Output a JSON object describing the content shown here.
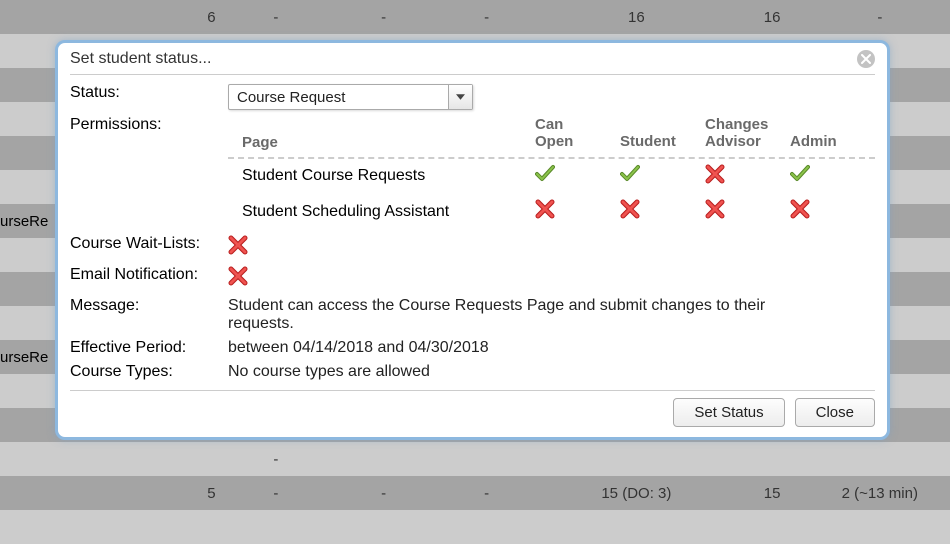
{
  "bg": {
    "partial_label": "urseRe",
    "row0": {
      "c1": "6",
      "c2": "-",
      "c3": "-",
      "c4": "-",
      "c5": "16",
      "c6": "16",
      "c7": "-"
    },
    "row_mid": {
      "c2": "-"
    },
    "row_last": {
      "c1": "5",
      "c2": "-",
      "c3": "-",
      "c4": "-",
      "c5": "15 (DO: 3)",
      "c6": "15",
      "c7": "2 (~13 min)"
    }
  },
  "dialog": {
    "title": "Set student status...",
    "labels": {
      "status": "Status:",
      "permissions": "Permissions:",
      "wait_lists": "Course Wait-Lists:",
      "email": "Email Notification:",
      "message": "Message:",
      "period": "Effective Period:",
      "types": "Course Types:"
    },
    "status_value": "Course Request",
    "perm_headers": {
      "page": "Page",
      "can_open": "Can\nOpen",
      "student": "Student",
      "changes_advisor": "Changes\nAdvisor",
      "admin": "Admin"
    },
    "perm_rows": [
      {
        "page": "Student Course Requests",
        "can_open": true,
        "student": true,
        "changes_advisor": false,
        "admin": true
      },
      {
        "page": "Student Scheduling Assistant",
        "can_open": false,
        "student": false,
        "changes_advisor": false,
        "admin": false
      }
    ],
    "wait_lists": false,
    "email": false,
    "message": "Student can access the Course Requests Page and submit changes to their requests.",
    "period": "between 04/14/2018 and 04/30/2018",
    "types": "No course types are allowed",
    "buttons": {
      "set_status": "Set Status",
      "close": "Close"
    }
  }
}
